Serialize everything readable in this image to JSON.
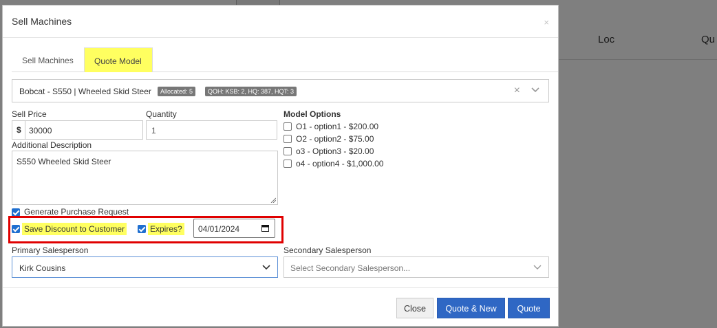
{
  "background": {
    "columns": [
      "Loc",
      "Qu"
    ]
  },
  "modal": {
    "title": "Sell Machines",
    "close_glyph": "×"
  },
  "tabs": [
    {
      "label": "Sell Machines",
      "active": false
    },
    {
      "label": "Quote Model",
      "active": true
    }
  ],
  "model_select": {
    "value": "Bobcat - S550 | Wheeled Skid Steer",
    "badges": [
      "Allocated: 5",
      "QOH: KSB: 2, HQ: 387, HQT: 3"
    ],
    "clear_glyph": "×",
    "caret_icon": "chevron-down-icon"
  },
  "form": {
    "sell_price_label": "Sell Price",
    "currency_symbol": "$",
    "sell_price_value": "30000",
    "quantity_label": "Quantity",
    "quantity_placeholder": "1",
    "additional_description_label": "Additional Description",
    "additional_description_value": "S550 Wheeled Skid Steer",
    "generate_pr_label": "Generate Purchase Request",
    "save_discount_label": "Save Discount to Customer",
    "expires_label": "Expires?",
    "expires_date": "04/01/2024",
    "primary_salesperson_label": "Primary Salesperson",
    "primary_salesperson_value": "Kirk Cousins",
    "secondary_salesperson_label": "Secondary Salesperson",
    "secondary_salesperson_placeholder": "Select Secondary Salesperson..."
  },
  "model_options": {
    "label": "Model Options",
    "items": [
      {
        "label": "O1 - option1 - $200.00",
        "checked": false
      },
      {
        "label": "O2 - option2 - $75.00",
        "checked": false
      },
      {
        "label": "o3 - Option3 - $20.00",
        "checked": false
      },
      {
        "label": "o4 - option4 - $1,000.00",
        "checked": false
      }
    ]
  },
  "buttons": {
    "close": "Close",
    "quote_new": "Quote & New",
    "quote": "Quote"
  },
  "colors": {
    "highlight": "#ffff60",
    "primary_button": "#2f67c4",
    "annotation_box": "#e00000",
    "checkbox": "#1f6fd0"
  }
}
